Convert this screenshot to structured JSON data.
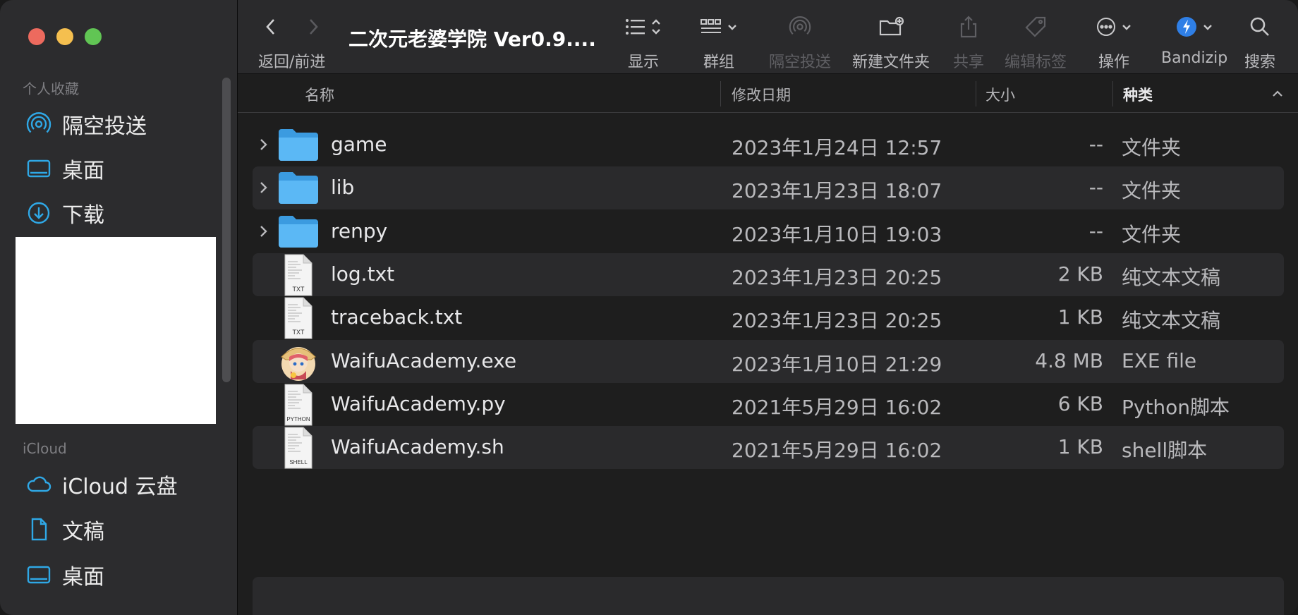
{
  "window": {
    "title": "二次元老婆学院 Ver0.9....",
    "traffic_lights": {
      "close": "#ed6a5e",
      "minimize": "#f5bf4f",
      "maximize": "#61c554"
    }
  },
  "sidebar": {
    "favorites_title": "个人收藏",
    "favorites": [
      {
        "label": "隔空投送",
        "icon": "airdrop-icon"
      },
      {
        "label": "桌面",
        "icon": "desktop-icon"
      },
      {
        "label": "下载",
        "icon": "download-icon"
      }
    ],
    "icloud_title": "iCloud",
    "icloud": [
      {
        "label": "iCloud 云盘",
        "icon": "cloud-icon"
      },
      {
        "label": "文稿",
        "icon": "document-icon"
      },
      {
        "label": "桌面",
        "icon": "desktop-icon"
      }
    ],
    "accent": "#2fa8e6"
  },
  "toolbar": {
    "nav_label": "返回/前进",
    "view_label": "显示",
    "group_label": "群组",
    "airdrop_label": "隔空投送",
    "new_folder_label": "新建文件夹",
    "share_label": "共享",
    "tags_label": "编辑标签",
    "action_label": "操作",
    "bandizip_label": "Bandizip",
    "search_label": "搜索"
  },
  "columns": {
    "name": "名称",
    "date": "修改日期",
    "size": "大小",
    "kind": "种类"
  },
  "files": [
    {
      "name": "game",
      "date": "2023年1月24日 12:57",
      "size": "--",
      "kind": "文件夹",
      "type": "folder"
    },
    {
      "name": "lib",
      "date": "2023年1月23日 18:07",
      "size": "--",
      "kind": "文件夹",
      "type": "folder"
    },
    {
      "name": "renpy",
      "date": "2023年1月10日 19:03",
      "size": "--",
      "kind": "文件夹",
      "type": "folder"
    },
    {
      "name": "log.txt",
      "date": "2023年1月23日 20:25",
      "size": "2 KB",
      "kind": "纯文本文稿",
      "type": "doc",
      "badge": "TXT"
    },
    {
      "name": "traceback.txt",
      "date": "2023年1月23日 20:25",
      "size": "1 KB",
      "kind": "纯文本文稿",
      "type": "doc",
      "badge": "TXT"
    },
    {
      "name": "WaifuAcademy.exe",
      "date": "2023年1月10日 21:29",
      "size": "4.8 MB",
      "kind": "EXE file",
      "type": "app"
    },
    {
      "name": "WaifuAcademy.py",
      "date": "2021年5月29日 16:02",
      "size": "6 KB",
      "kind": "Python脚本",
      "type": "doc",
      "badge": "PYTHON"
    },
    {
      "name": "WaifuAcademy.sh",
      "date": "2021年5月29日 16:02",
      "size": "1 KB",
      "kind": "shell脚本",
      "type": "doc",
      "badge": "SHELL"
    }
  ]
}
